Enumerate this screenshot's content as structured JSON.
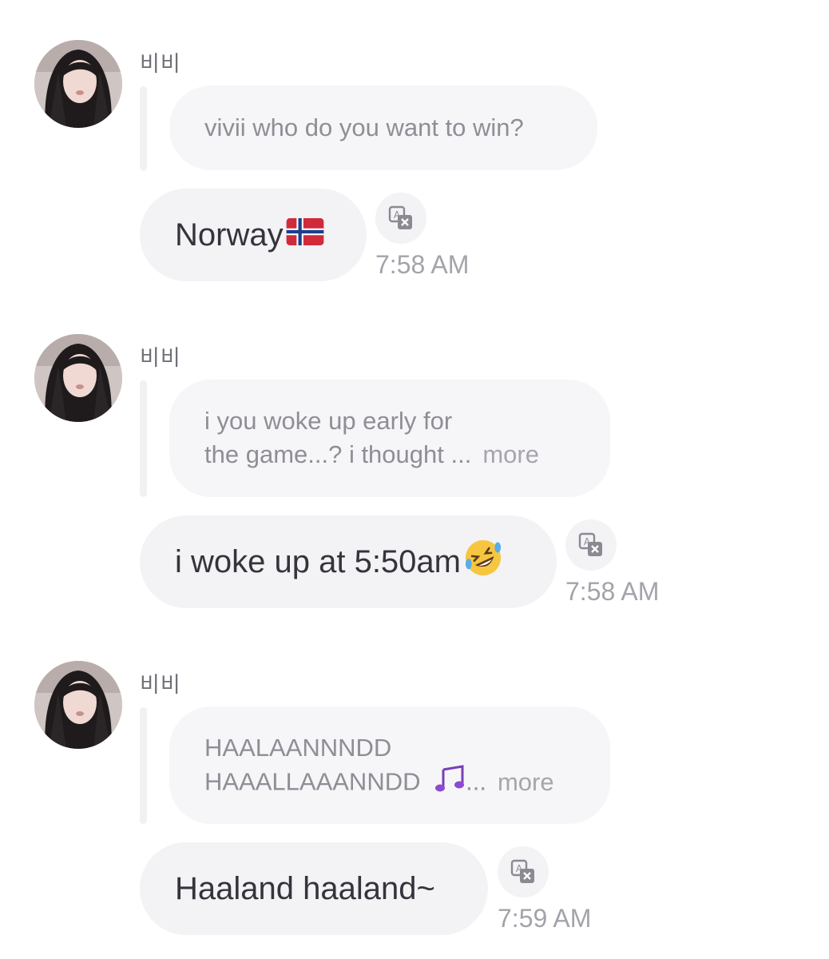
{
  "messages": [
    {
      "sender": "비비",
      "reply": {
        "lines": [
          "vivii who do you want to win?"
        ],
        "more": ""
      },
      "text": "Norway",
      "emoji": "norway-flag",
      "time": "7:58 AM"
    },
    {
      "sender": "비비",
      "reply": {
        "lines": [
          "i you woke up early for",
          "the game...? i thought ..."
        ],
        "more": "more"
      },
      "text": "i woke up at 5:50am",
      "emoji": "rofl-face",
      "time": "7:58 AM"
    },
    {
      "sender": "비비",
      "reply": {
        "lines": [
          "HAALAANNNDD",
          "HAAALLAAANNDD"
        ],
        "line2_suffix": "...",
        "more": "more"
      },
      "text": "Haaland haaland~",
      "time": "7:59 AM"
    }
  ],
  "icons": {
    "translate": "translate-icon",
    "music_notes": "music-notes-icon"
  },
  "colors": {
    "bubble": "#f3f3f6",
    "reply_bubble": "#f6f6f8",
    "time": "#a3a3aa",
    "sender": "#707078"
  }
}
